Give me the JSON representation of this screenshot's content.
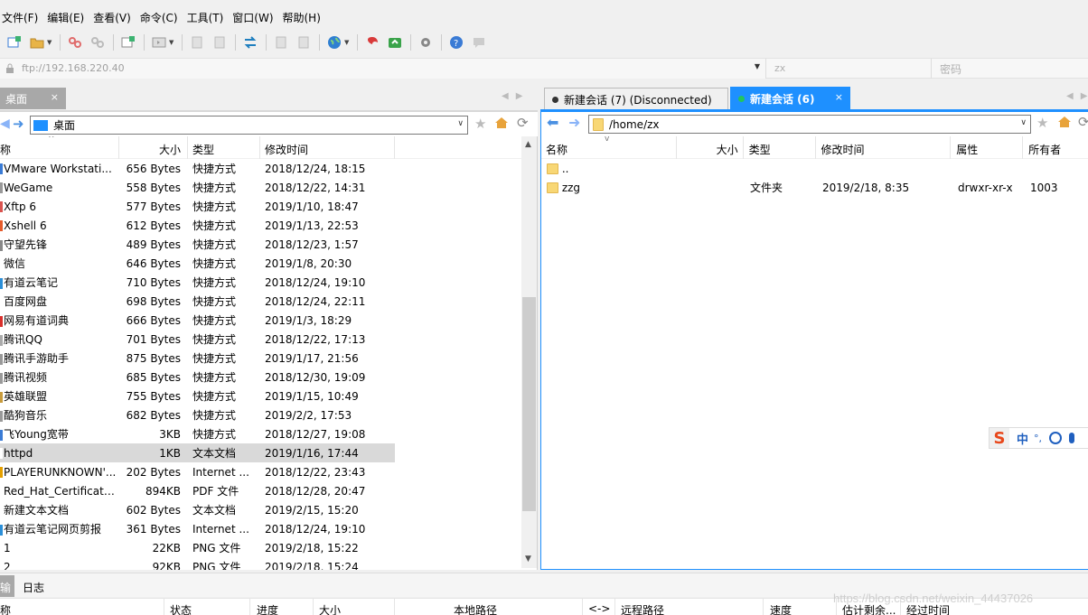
{
  "menubar": [
    "文件(F)",
    "编辑(E)",
    "查看(V)",
    "命令(C)",
    "工具(T)",
    "窗口(W)",
    "帮助(H)"
  ],
  "address": {
    "host": "ftp://192.168.220.40",
    "user_placeholder": "zx",
    "password_placeholder": "密码"
  },
  "left": {
    "tab": "桌面",
    "tab_close": "×",
    "path": "桌面",
    "columns": [
      "称",
      "大小",
      "类型",
      "修改时间"
    ],
    "rows": [
      {
        "name": "VMware Workstati...",
        "size": "656 Bytes",
        "type": "快捷方式",
        "mtime": "2018/12/24, 18:15",
        "icon": "#3a7bd5"
      },
      {
        "name": "WeGame",
        "size": "558 Bytes",
        "type": "快捷方式",
        "mtime": "2018/12/22, 14:31",
        "icon": "#999999"
      },
      {
        "name": "Xftp 6",
        "size": "577 Bytes",
        "type": "快捷方式",
        "mtime": "2019/1/10, 18:47",
        "icon": "#d9534f"
      },
      {
        "name": "Xshell 6",
        "size": "612 Bytes",
        "type": "快捷方式",
        "mtime": "2019/1/13, 22:53",
        "icon": "#e55b2b"
      },
      {
        "name": "守望先锋",
        "size": "489 Bytes",
        "type": "快捷方式",
        "mtime": "2018/12/23, 1:57",
        "icon": "#888888"
      },
      {
        "name": "微信",
        "size": "646 Bytes",
        "type": "快捷方式",
        "mtime": "2019/1/8, 20:30",
        "icon": "#ffffff"
      },
      {
        "name": "有道云笔记",
        "size": "710 Bytes",
        "type": "快捷方式",
        "mtime": "2018/12/24, 19:10",
        "icon": "#2b8fd8"
      },
      {
        "name": "百度网盘",
        "size": "698 Bytes",
        "type": "快捷方式",
        "mtime": "2018/12/24, 22:11",
        "icon": "#ffffff"
      },
      {
        "name": "网易有道词典",
        "size": "666 Bytes",
        "type": "快捷方式",
        "mtime": "2019/1/3, 18:29",
        "icon": "#d9302c"
      },
      {
        "name": "腾讯QQ",
        "size": "701 Bytes",
        "type": "快捷方式",
        "mtime": "2018/12/22, 17:13",
        "icon": "#aaaaaa"
      },
      {
        "name": "腾讯手游助手",
        "size": "875 Bytes",
        "type": "快捷方式",
        "mtime": "2019/1/17, 21:56",
        "icon": "#999999"
      },
      {
        "name": "腾讯视频",
        "size": "685 Bytes",
        "type": "快捷方式",
        "mtime": "2018/12/30, 19:09",
        "icon": "#999999"
      },
      {
        "name": "英雄联盟",
        "size": "755 Bytes",
        "type": "快捷方式",
        "mtime": "2019/1/15, 10:49",
        "icon": "#c89b3c"
      },
      {
        "name": "酷狗音乐",
        "size": "682 Bytes",
        "type": "快捷方式",
        "mtime": "2019/2/2, 17:53",
        "icon": "#999999"
      },
      {
        "name": "飞Young宽带",
        "size": "3KB",
        "type": "快捷方式",
        "mtime": "2018/12/27, 19:08",
        "icon": "#3a7bd5"
      },
      {
        "name": "httpd",
        "size": "1KB",
        "type": "文本文档",
        "mtime": "2019/1/16, 17:44",
        "icon": "#ffffff"
      },
      {
        "name": "PLAYERUNKNOWN'...",
        "size": "202 Bytes",
        "type": "Internet ...",
        "mtime": "2018/12/22, 23:43",
        "icon": "#e5a000"
      },
      {
        "name": "Red_Hat_Certificate...",
        "size": "894KB",
        "type": "PDF 文件",
        "mtime": "2018/12/28, 20:47",
        "icon": "#ffffff"
      },
      {
        "name": "新建文本文档",
        "size": "602 Bytes",
        "type": "文本文档",
        "mtime": "2019/2/15, 15:20",
        "icon": "#ffffff"
      },
      {
        "name": "有道云笔记网页剪报",
        "size": "361 Bytes",
        "type": "Internet ...",
        "mtime": "2018/12/24, 19:10",
        "icon": "#2b8fd8"
      },
      {
        "name": "1",
        "size": "22KB",
        "type": "PNG 文件",
        "mtime": "2019/2/18, 15:22",
        "icon": "#ffffff"
      },
      {
        "name": "2",
        "size": "92KB",
        "type": "PNG 文件",
        "mtime": "2019/2/18, 15:24",
        "icon": "#ffffff"
      }
    ],
    "selected_index": 15
  },
  "right": {
    "tab_inactive": "新建会话 (7) (Disconnected)",
    "tab_active": "新建会话 (6)",
    "tab_close": "×",
    "path": "/home/zx",
    "columns": [
      "名称",
      "大小",
      "类型",
      "修改时间",
      "属性",
      "所有者"
    ],
    "rows": [
      {
        "name": "..",
        "size": "",
        "type": "",
        "mtime": "",
        "perm": "",
        "owner": ""
      },
      {
        "name": "zzg",
        "size": "",
        "type": "文件夹",
        "mtime": "2019/2/18, 8:35",
        "perm": "drwxr-xr-x",
        "owner": "1003"
      }
    ]
  },
  "ime": {
    "logo": "S",
    "lang": "中",
    "punct": "°,"
  },
  "bottom": {
    "tab_transfer": "输",
    "tab_log": "日志",
    "columns": [
      "称",
      "状态",
      "进度",
      "大小",
      "本地路径",
      "<->",
      "远程路径",
      "速度",
      "估计剩余...",
      "经过时间"
    ]
  },
  "watermark": "https://blog.csdn.net/weixin_44437026",
  "colors": {
    "accent": "#1e90ff",
    "selected_row": "#d9d9d9",
    "inactive_tab": "#a8a8a8",
    "connected_dot": "#22c55e"
  }
}
